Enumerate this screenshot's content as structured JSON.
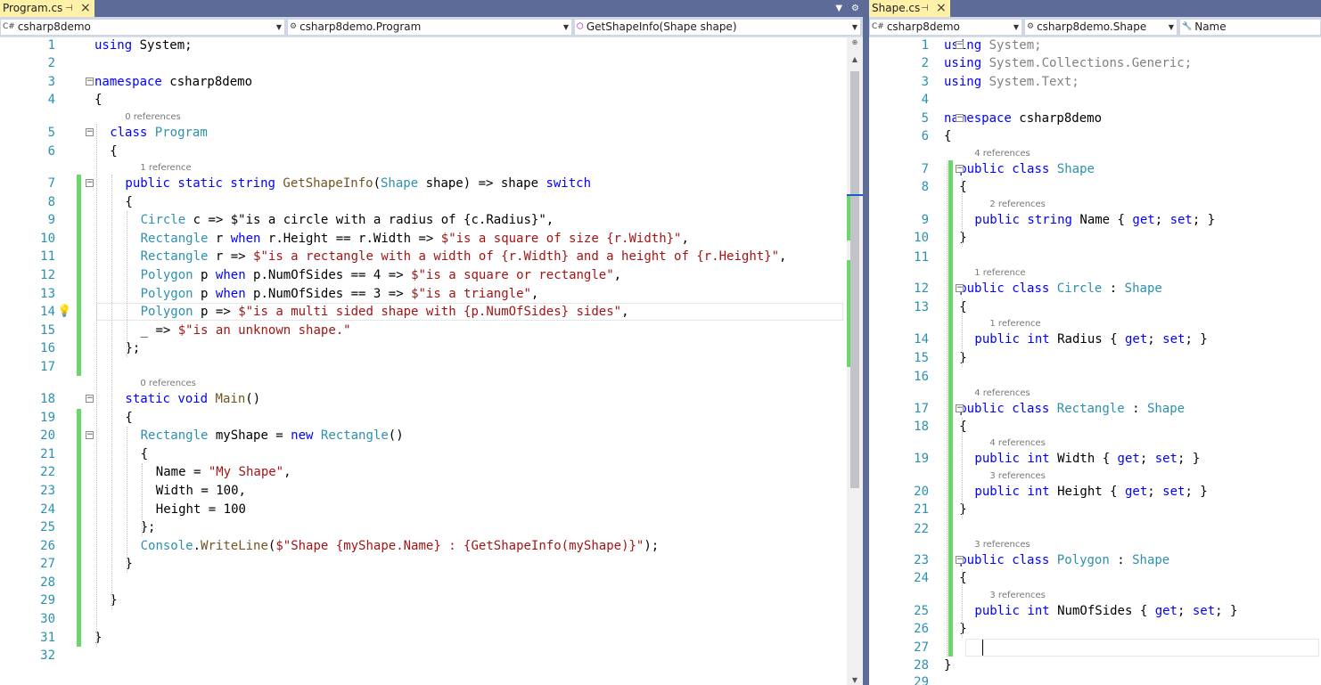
{
  "colors": {
    "tab_active": "#fff1a8",
    "chrome": "#5d6b99",
    "navbar": "#cfd6e5",
    "keyword": "#0000ff",
    "type": "#2b91af",
    "string": "#a31515",
    "method": "#74531f",
    "change_marker": "#6bd66b"
  },
  "left": {
    "tab": {
      "title": "Program.cs"
    },
    "nav": {
      "project": "csharp8demo",
      "type": "csharp8demo.Program",
      "member": "GetShapeInfo(Shape shape)"
    },
    "lines": [
      {
        "n": "1",
        "t": [
          [
            "using",
            "kw"
          ],
          [
            " System;",
            ""
          ]
        ]
      },
      {
        "n": "2",
        "t": []
      },
      {
        "n": "3",
        "t": [
          [
            "namespace",
            "kw"
          ],
          [
            " csharp8demo",
            ""
          ]
        ]
      },
      {
        "n": "4",
        "t": [
          [
            "{",
            ""
          ]
        ]
      },
      {
        "n": "5",
        "ref": "0 references",
        "t": [
          [
            "class",
            "kw"
          ],
          [
            " ",
            ""
          ],
          [
            "Program",
            "ty"
          ]
        ]
      },
      {
        "n": "6",
        "t": [
          [
            "{",
            ""
          ]
        ]
      },
      {
        "n": "7",
        "ref": "1 reference",
        "t": [
          [
            "public static string",
            "kw"
          ],
          [
            " ",
            ""
          ],
          [
            "GetShapeInfo",
            "mt"
          ],
          [
            "(",
            ""
          ],
          [
            "Shape",
            "ty"
          ],
          [
            " shape) => shape ",
            ""
          ],
          [
            "switch",
            "kw"
          ]
        ]
      },
      {
        "n": "8",
        "t": [
          [
            "{",
            ""
          ]
        ]
      },
      {
        "n": "9",
        "t": [
          [
            "Circle",
            "ty"
          ],
          [
            " c => ",
            ""
          ],
          [
            "$\"is a circle with a radius of ",
            ""
          ],
          [
            "{",
            ""
          ],
          [
            "c.Radius",
            ""
          ],
          [
            "}\"",
            ""
          ],
          [
            ",",
            ""
          ]
        ]
      },
      {
        "n": "10",
        "t": [
          [
            "Rectangle",
            "ty"
          ],
          [
            " r ",
            ""
          ],
          [
            "when",
            "kw"
          ],
          [
            " r.Height == r.Width => ",
            ""
          ],
          [
            "$\"is a square of size {r.Width}\"",
            "st"
          ],
          [
            ",",
            ""
          ]
        ]
      },
      {
        "n": "11",
        "t": [
          [
            "Rectangle",
            "ty"
          ],
          [
            " r => ",
            ""
          ],
          [
            "$\"is a rectangle with a width of {r.Width} and a height of {r.Height}\"",
            "st"
          ],
          [
            ",",
            ""
          ]
        ]
      },
      {
        "n": "12",
        "t": [
          [
            "Polygon",
            "ty"
          ],
          [
            " p ",
            ""
          ],
          [
            "when",
            "kw"
          ],
          [
            " p.NumOfSides == 4 => ",
            ""
          ],
          [
            "$\"is a square or rectangle\"",
            "st"
          ],
          [
            ",",
            ""
          ]
        ]
      },
      {
        "n": "13",
        "t": [
          [
            "Polygon",
            "ty"
          ],
          [
            " p ",
            ""
          ],
          [
            "when",
            "kw"
          ],
          [
            " p.NumOfSides == 3 => ",
            ""
          ],
          [
            "$\"is a triangle\"",
            "st"
          ],
          [
            ",",
            ""
          ]
        ]
      },
      {
        "n": "14",
        "t": [
          [
            "Polygon",
            "ty"
          ],
          [
            " p => ",
            ""
          ],
          [
            "$\"is a multi sided shape with {p.NumOfSides} sides\"",
            "st"
          ],
          [
            ",",
            ""
          ]
        ]
      },
      {
        "n": "15",
        "t": [
          [
            "_ => ",
            ""
          ],
          [
            "$\"is an unknown shape.\"",
            "st"
          ]
        ]
      },
      {
        "n": "16",
        "t": [
          [
            "};",
            ""
          ]
        ]
      },
      {
        "n": "17",
        "t": []
      },
      {
        "n": "18",
        "ref": "0 references",
        "t": [
          [
            "static void",
            "kw"
          ],
          [
            " ",
            ""
          ],
          [
            "Main",
            "mt"
          ],
          [
            "()",
            ""
          ]
        ]
      },
      {
        "n": "19",
        "t": [
          [
            "{",
            ""
          ]
        ]
      },
      {
        "n": "20",
        "t": [
          [
            "Rectangle",
            "ty"
          ],
          [
            " myShape = ",
            ""
          ],
          [
            "new",
            "kw"
          ],
          [
            " ",
            ""
          ],
          [
            "Rectangle",
            "ty"
          ],
          [
            "()",
            ""
          ]
        ]
      },
      {
        "n": "21",
        "t": [
          [
            "{",
            ""
          ]
        ]
      },
      {
        "n": "22",
        "t": [
          [
            "Name = ",
            ""
          ],
          [
            "\"My Shape\"",
            "st"
          ],
          [
            ",",
            ""
          ]
        ]
      },
      {
        "n": "23",
        "t": [
          [
            "Width = 100,",
            ""
          ]
        ]
      },
      {
        "n": "24",
        "t": [
          [
            "Height = 100",
            ""
          ]
        ]
      },
      {
        "n": "25",
        "t": [
          [
            "};",
            ""
          ]
        ]
      },
      {
        "n": "26",
        "t": [
          [
            "Console",
            "ty"
          ],
          [
            ".",
            ""
          ],
          [
            "WriteLine",
            "mt"
          ],
          [
            "(",
            ""
          ],
          [
            "$\"Shape {myShape.Name} : {GetShapeInfo(myShape)}\"",
            "st"
          ],
          [
            ");",
            ""
          ]
        ]
      },
      {
        "n": "27",
        "t": [
          [
            "}",
            ""
          ]
        ]
      },
      {
        "n": "28",
        "t": []
      },
      {
        "n": "29",
        "t": [
          [
            "}",
            ""
          ]
        ]
      },
      {
        "n": "30",
        "t": []
      },
      {
        "n": "31",
        "t": [
          [
            "}",
            ""
          ]
        ]
      },
      {
        "n": "32",
        "t": []
      }
    ]
  },
  "right": {
    "tab": {
      "title": "Shape.cs"
    },
    "nav": {
      "project": "csharp8demo",
      "type": "csharp8demo.Shape",
      "member": "Name"
    },
    "lines": [
      {
        "n": "1",
        "t": [
          [
            "using",
            "kw"
          ],
          [
            " System;",
            "gr"
          ]
        ]
      },
      {
        "n": "2",
        "t": [
          [
            "using",
            "kw"
          ],
          [
            " System.Collections.Generic;",
            "gr"
          ]
        ]
      },
      {
        "n": "3",
        "t": [
          [
            "using",
            "kw"
          ],
          [
            " System.Text;",
            "gr"
          ]
        ]
      },
      {
        "n": "4",
        "t": []
      },
      {
        "n": "5",
        "t": [
          [
            "namespace",
            "kw"
          ],
          [
            " csharp8demo",
            ""
          ]
        ]
      },
      {
        "n": "6",
        "t": [
          [
            "{",
            ""
          ]
        ]
      },
      {
        "n": "7",
        "ref": "4 references",
        "t": [
          [
            "public class",
            "kw"
          ],
          [
            " ",
            ""
          ],
          [
            "Shape",
            "ty"
          ]
        ]
      },
      {
        "n": "8",
        "t": [
          [
            "{",
            ""
          ]
        ]
      },
      {
        "n": "9",
        "ref": "2 references",
        "t": [
          [
            "public string",
            "kw"
          ],
          [
            " Name { ",
            ""
          ],
          [
            "get",
            "kw"
          ],
          [
            "; ",
            ""
          ],
          [
            "set",
            "kw"
          ],
          [
            "; }",
            ""
          ]
        ]
      },
      {
        "n": "10",
        "t": [
          [
            "}",
            ""
          ]
        ]
      },
      {
        "n": "11",
        "t": []
      },
      {
        "n": "12",
        "ref": "1 reference",
        "t": [
          [
            "public class",
            "kw"
          ],
          [
            " ",
            ""
          ],
          [
            "Circle",
            "ty"
          ],
          [
            " : ",
            ""
          ],
          [
            "Shape",
            "ty"
          ]
        ]
      },
      {
        "n": "13",
        "t": [
          [
            "{",
            ""
          ]
        ]
      },
      {
        "n": "14",
        "ref": "1 reference",
        "t": [
          [
            "public int",
            "kw"
          ],
          [
            " Radius { ",
            ""
          ],
          [
            "get",
            "kw"
          ],
          [
            "; ",
            ""
          ],
          [
            "set",
            "kw"
          ],
          [
            "; }",
            ""
          ]
        ]
      },
      {
        "n": "15",
        "t": [
          [
            "}",
            ""
          ]
        ]
      },
      {
        "n": "16",
        "t": []
      },
      {
        "n": "17",
        "ref": "4 references",
        "t": [
          [
            "public class",
            "kw"
          ],
          [
            " ",
            ""
          ],
          [
            "Rectangle",
            "ty"
          ],
          [
            " : ",
            ""
          ],
          [
            "Shape",
            "ty"
          ]
        ]
      },
      {
        "n": "18",
        "t": [
          [
            "{",
            ""
          ]
        ]
      },
      {
        "n": "19",
        "ref": "4 references",
        "t": [
          [
            "public int",
            "kw"
          ],
          [
            " Width { ",
            ""
          ],
          [
            "get",
            "kw"
          ],
          [
            "; ",
            ""
          ],
          [
            "set",
            "kw"
          ],
          [
            "; }",
            ""
          ]
        ]
      },
      {
        "n": "20",
        "ref": "3 references",
        "t": [
          [
            "public int",
            "kw"
          ],
          [
            " Height { ",
            ""
          ],
          [
            "get",
            "kw"
          ],
          [
            "; ",
            ""
          ],
          [
            "set",
            "kw"
          ],
          [
            "; }",
            ""
          ]
        ]
      },
      {
        "n": "21",
        "t": [
          [
            "}",
            ""
          ]
        ]
      },
      {
        "n": "22",
        "t": []
      },
      {
        "n": "23",
        "ref": "3 references",
        "t": [
          [
            "public class",
            "kw"
          ],
          [
            " ",
            ""
          ],
          [
            "Polygon",
            "ty"
          ],
          [
            " : ",
            ""
          ],
          [
            "Shape",
            "ty"
          ]
        ]
      },
      {
        "n": "24",
        "t": [
          [
            "{",
            ""
          ]
        ]
      },
      {
        "n": "25",
        "ref": "3 references",
        "t": [
          [
            "public int",
            "kw"
          ],
          [
            " NumOfSides { ",
            ""
          ],
          [
            "get",
            "kw"
          ],
          [
            "; ",
            ""
          ],
          [
            "set",
            "kw"
          ],
          [
            "; }",
            ""
          ]
        ]
      },
      {
        "n": "26",
        "t": [
          [
            "}",
            ""
          ]
        ]
      },
      {
        "n": "27",
        "t": []
      },
      {
        "n": "28",
        "t": [
          [
            "}",
            ""
          ]
        ]
      },
      {
        "n": "29",
        "t": []
      }
    ]
  }
}
